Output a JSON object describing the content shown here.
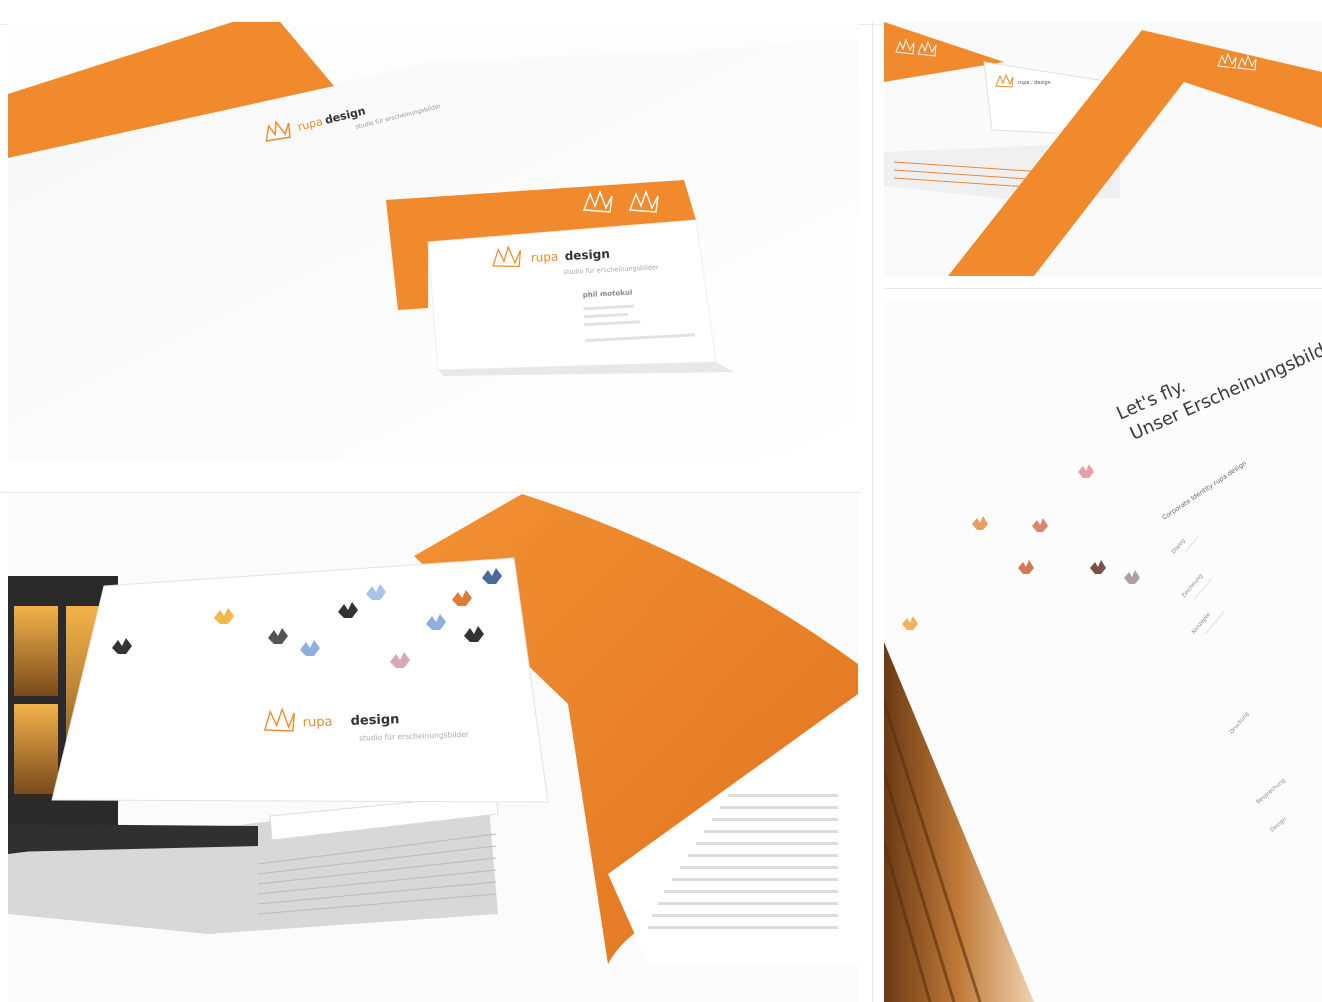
{
  "colors": {
    "brand_orange": "#f08a2c",
    "text_dark": "#333333",
    "text_grey": "#999999",
    "paper": "#ffffff"
  },
  "logo": {
    "name_part1": "rupa",
    "name_sep": " , ",
    "name_part2": "design",
    "tagline_envelope": "studio für erscheinungsbilder",
    "tagline_card": "studio für erscheinungsbilder",
    "tagline_brochure": "studio für erscheinungsbilder",
    "small_mark": "rupa , design"
  },
  "business_card": {
    "person_name": "phil motokul"
  },
  "brochure_page": {
    "headline_line1": "Let's fly.",
    "headline_line2": "Unser Erscheinungsbild.",
    "subheading": "Corporate Identity rupa design",
    "rows": [
      "Dialog",
      "Zeichnung",
      "Konzepte",
      "Druckung",
      "Besprechung",
      "Design"
    ]
  },
  "icons": [
    "origami-crane-icon"
  ]
}
